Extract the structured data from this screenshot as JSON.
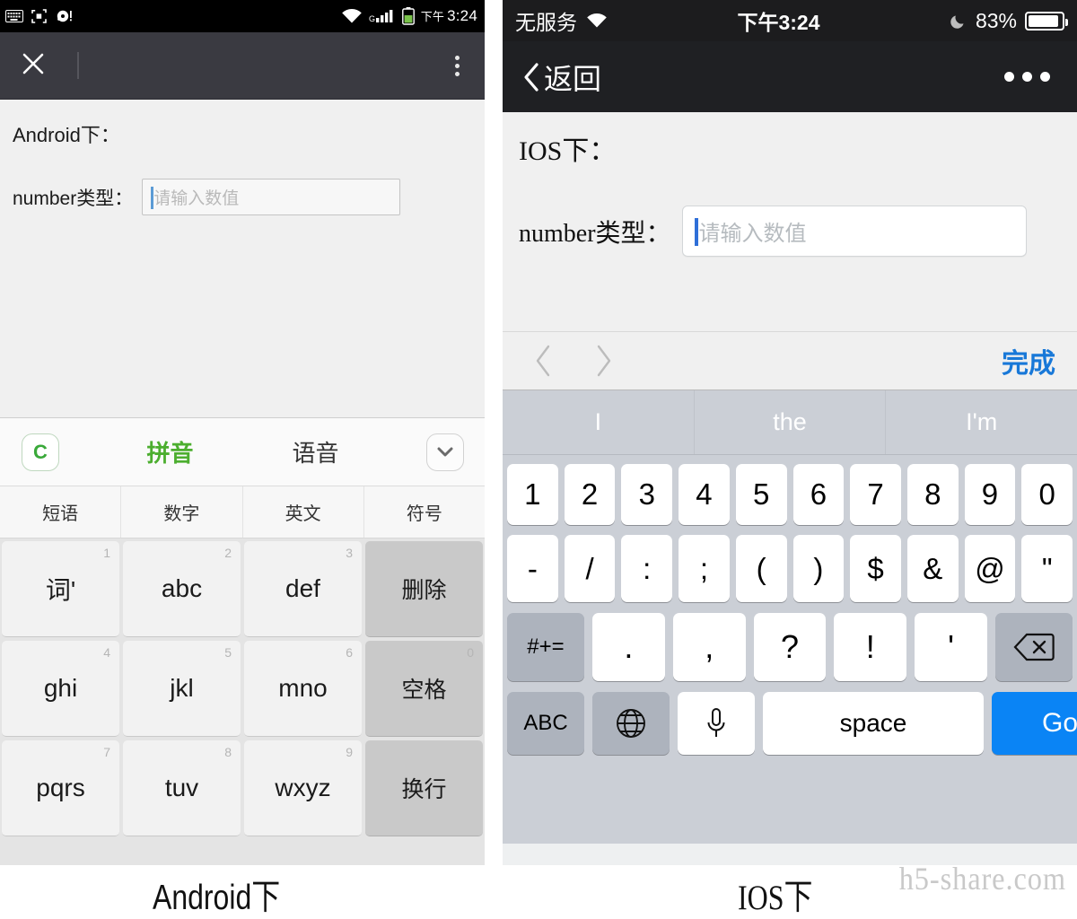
{
  "android": {
    "statusbar": {
      "icons": [
        "keyboard-icon",
        "screenshot-icon",
        "alarm-icon"
      ],
      "wifi_icon": "wifi-icon",
      "signal_icon": "signal-icon",
      "signal_label": "G",
      "battery_icon": "battery-icon",
      "ampm": "下午",
      "time": "3:24"
    },
    "toolbar": {
      "close_icon": "close-icon",
      "menu_icon": "overflow-menu-icon"
    },
    "page": {
      "title": "Android下：",
      "field_label": "number类型：",
      "input_placeholder": "请输入数值",
      "input_value": ""
    },
    "keyboard": {
      "logo": "C",
      "tabs": [
        {
          "label": "拼音",
          "active": true
        },
        {
          "label": "语音",
          "active": false
        }
      ],
      "collapse_icon": "chevron-down-icon",
      "subtabs": [
        "短语",
        "数字",
        "英文",
        "符号"
      ],
      "rows": [
        [
          {
            "label": "词'",
            "num": "1",
            "fn": false
          },
          {
            "label": "abc",
            "num": "2",
            "fn": false
          },
          {
            "label": "def",
            "num": "3",
            "fn": false
          },
          {
            "label": "删除",
            "num": "",
            "fn": true
          }
        ],
        [
          {
            "label": "ghi",
            "num": "4",
            "fn": false
          },
          {
            "label": "jkl",
            "num": "5",
            "fn": false
          },
          {
            "label": "mno",
            "num": "6",
            "fn": false
          },
          {
            "label": "空格",
            "num": "0",
            "fn": true
          }
        ],
        [
          {
            "label": "pqrs",
            "num": "7",
            "fn": false
          },
          {
            "label": "tuv",
            "num": "8",
            "fn": false
          },
          {
            "label": "wxyz",
            "num": "9",
            "fn": false
          },
          {
            "label": "换行",
            "num": "",
            "fn": true
          }
        ]
      ]
    },
    "caption": "Android下"
  },
  "ios": {
    "statusbar": {
      "carrier": "无服务",
      "wifi_icon": "wifi-icon",
      "time": "下午3:24",
      "moon_icon": "do-not-disturb-moon-icon",
      "battery_percent": "83%",
      "battery_icon": "battery-icon"
    },
    "navbar": {
      "back_icon": "chevron-left-icon",
      "back_label": "返回",
      "more_icon": "more-dots-icon"
    },
    "page": {
      "title": "IOS下：",
      "field_label": "number类型：",
      "input_placeholder": "请输入数值",
      "input_value": ""
    },
    "accessory": {
      "prev_icon": "chevron-left-icon",
      "next_icon": "chevron-right-icon",
      "done_label": "完成",
      "done_color": "#1878d8"
    },
    "keyboard": {
      "predictions": [
        "I",
        "the",
        "I'm"
      ],
      "row_numbers": [
        "1",
        "2",
        "3",
        "4",
        "5",
        "6",
        "7",
        "8",
        "9",
        "0"
      ],
      "row_symbols": [
        "-",
        "/",
        ":",
        ";",
        "(",
        ")",
        "$",
        "&",
        "@",
        "\""
      ],
      "row_punct": [
        "#+=",
        ".",
        ",",
        "?",
        "!",
        "'",
        "backspace-icon"
      ],
      "bottom": {
        "abc_label": "ABC",
        "globe_icon": "globe-icon",
        "mic_icon": "microphone-icon",
        "space_label": "space",
        "go_label": "Go",
        "go_color": "#0a84f5"
      }
    },
    "caption": "IOS下"
  },
  "watermark": "h5-share.com"
}
